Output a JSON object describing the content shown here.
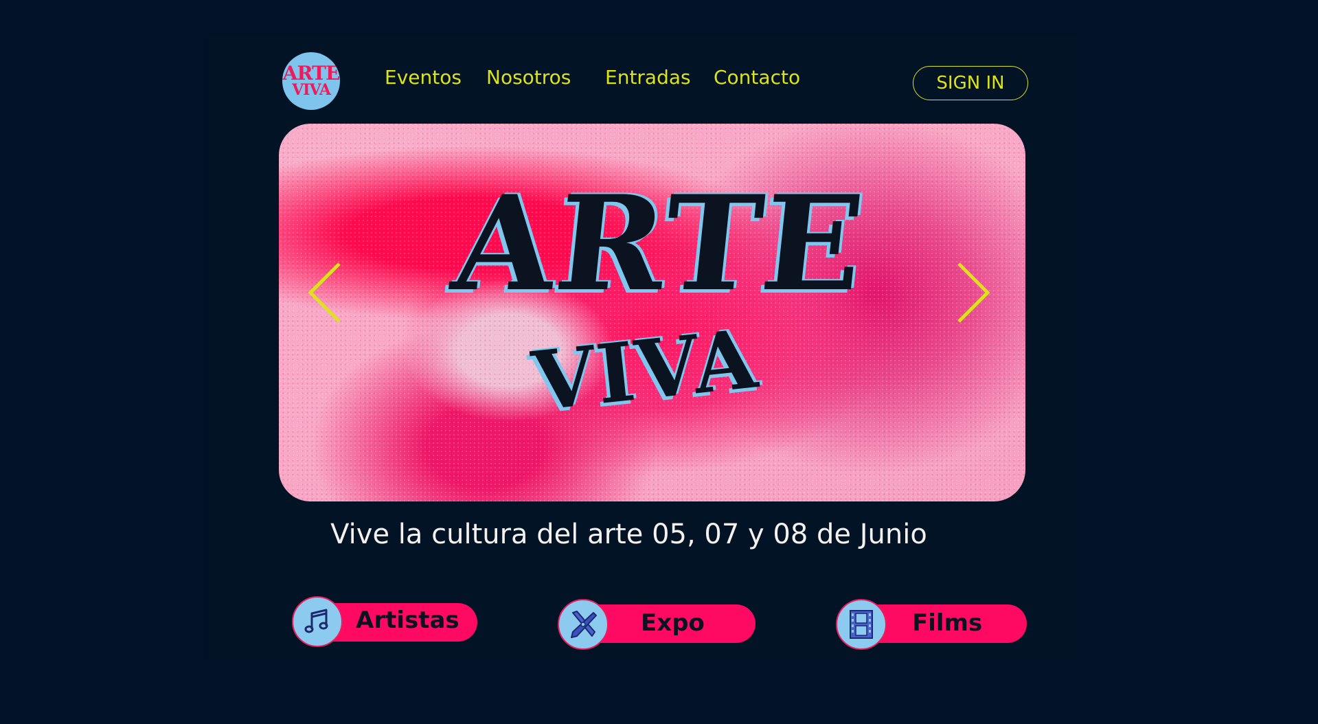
{
  "header": {
    "logo": {
      "line1": "ARTE",
      "line2": "VIVA"
    },
    "nav": [
      {
        "label": "Eventos"
      },
      {
        "label": "Nosotros"
      },
      {
        "label": "Entradas"
      },
      {
        "label": "Contacto"
      }
    ],
    "signin_label": "SIGN IN"
  },
  "hero": {
    "title_line1": "ARTE",
    "title_line2": "VIVA",
    "prev_icon": "chevron-left-icon",
    "next_icon": "chevron-right-icon"
  },
  "tagline": "Vive la cultura del arte 05, 07 y 08 de Junio",
  "categories": [
    {
      "label": "Artistas",
      "icon": "music-note-icon"
    },
    {
      "label": "Expo",
      "icon": "art-tools-icon"
    },
    {
      "label": "Films",
      "icon": "film-strip-icon"
    }
  ],
  "colors": {
    "background": "#011126",
    "accent_yellow": "#dde21a",
    "accent_pink": "#ff0a63",
    "accent_blue": "#8ccaf0",
    "text_light": "#f4f1ee"
  }
}
